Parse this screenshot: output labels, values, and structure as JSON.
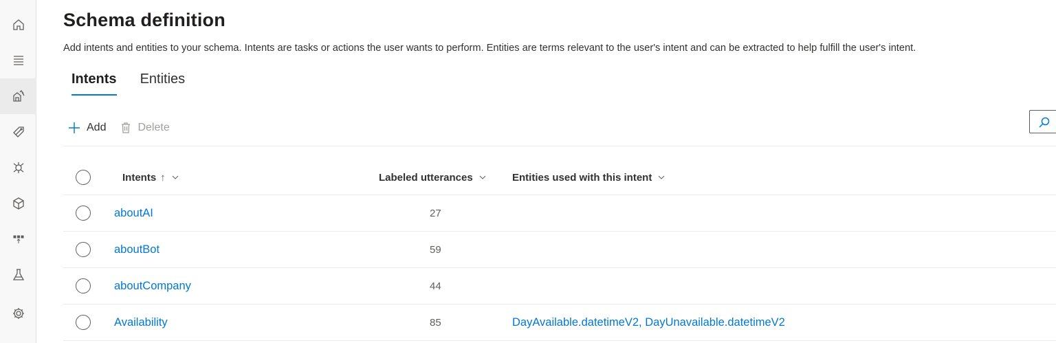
{
  "rail": {
    "items": [
      {
        "icon": "home-icon"
      },
      {
        "icon": "list-icon"
      },
      {
        "icon": "schema-icon",
        "active": true
      },
      {
        "icon": "tag-icon"
      },
      {
        "icon": "model-icon"
      },
      {
        "icon": "box-icon"
      },
      {
        "icon": "deploy-icon"
      },
      {
        "icon": "flask-icon"
      },
      {
        "icon": "gear-icon"
      }
    ]
  },
  "page": {
    "title": "Schema definition",
    "description": "Add intents and entities to your schema. Intents are tasks or actions the user wants to perform. Entities are terms relevant to the user's intent and can be extracted to help fulfill the user's intent."
  },
  "tabs": [
    {
      "label": "Intents",
      "active": true
    },
    {
      "label": "Entities",
      "active": false
    }
  ],
  "toolbar": {
    "add_label": "Add",
    "delete_label": "Delete"
  },
  "table": {
    "columns": {
      "intents": "Intents",
      "sort_arrow": "↑",
      "labeled": "Labeled utterances",
      "entities": "Entities used with this intent"
    },
    "rows": [
      {
        "name": "aboutAI",
        "count": "27",
        "entities": ""
      },
      {
        "name": "aboutBot",
        "count": "59",
        "entities": ""
      },
      {
        "name": "aboutCompany",
        "count": "44",
        "entities": ""
      },
      {
        "name": "Availability",
        "count": "85",
        "entities": "DayAvailable.datetimeV2, DayUnavailable.datetimeV2"
      }
    ]
  },
  "colors": {
    "accent": "#0078d4",
    "link": "#0078d4",
    "disabled": "#a19f9d"
  }
}
